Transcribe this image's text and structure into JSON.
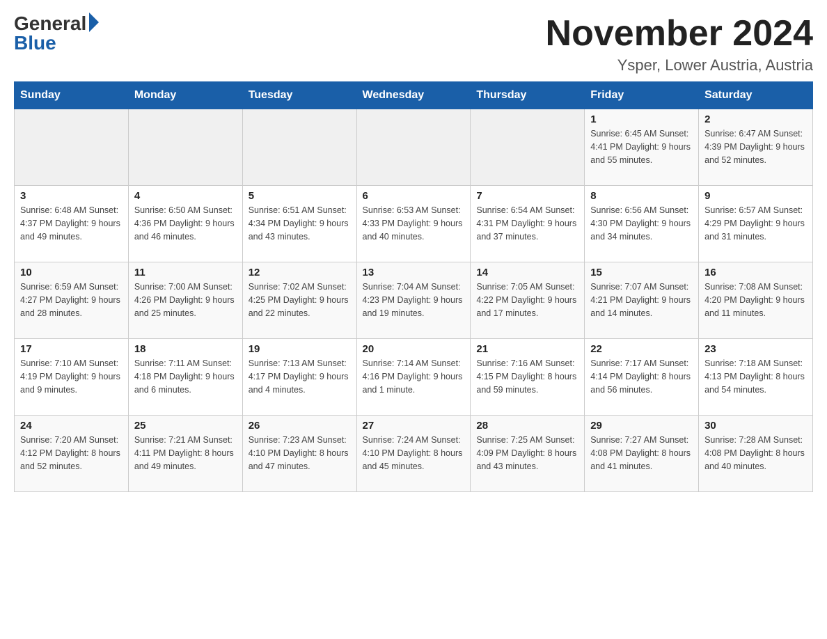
{
  "header": {
    "logo_general": "General",
    "logo_blue": "Blue",
    "month_title": "November 2024",
    "location": "Ysper, Lower Austria, Austria"
  },
  "days_of_week": [
    "Sunday",
    "Monday",
    "Tuesday",
    "Wednesday",
    "Thursday",
    "Friday",
    "Saturday"
  ],
  "weeks": [
    [
      {
        "day": "",
        "info": ""
      },
      {
        "day": "",
        "info": ""
      },
      {
        "day": "",
        "info": ""
      },
      {
        "day": "",
        "info": ""
      },
      {
        "day": "",
        "info": ""
      },
      {
        "day": "1",
        "info": "Sunrise: 6:45 AM\nSunset: 4:41 PM\nDaylight: 9 hours and 55 minutes."
      },
      {
        "day": "2",
        "info": "Sunrise: 6:47 AM\nSunset: 4:39 PM\nDaylight: 9 hours and 52 minutes."
      }
    ],
    [
      {
        "day": "3",
        "info": "Sunrise: 6:48 AM\nSunset: 4:37 PM\nDaylight: 9 hours and 49 minutes."
      },
      {
        "day": "4",
        "info": "Sunrise: 6:50 AM\nSunset: 4:36 PM\nDaylight: 9 hours and 46 minutes."
      },
      {
        "day": "5",
        "info": "Sunrise: 6:51 AM\nSunset: 4:34 PM\nDaylight: 9 hours and 43 minutes."
      },
      {
        "day": "6",
        "info": "Sunrise: 6:53 AM\nSunset: 4:33 PM\nDaylight: 9 hours and 40 minutes."
      },
      {
        "day": "7",
        "info": "Sunrise: 6:54 AM\nSunset: 4:31 PM\nDaylight: 9 hours and 37 minutes."
      },
      {
        "day": "8",
        "info": "Sunrise: 6:56 AM\nSunset: 4:30 PM\nDaylight: 9 hours and 34 minutes."
      },
      {
        "day": "9",
        "info": "Sunrise: 6:57 AM\nSunset: 4:29 PM\nDaylight: 9 hours and 31 minutes."
      }
    ],
    [
      {
        "day": "10",
        "info": "Sunrise: 6:59 AM\nSunset: 4:27 PM\nDaylight: 9 hours and 28 minutes."
      },
      {
        "day": "11",
        "info": "Sunrise: 7:00 AM\nSunset: 4:26 PM\nDaylight: 9 hours and 25 minutes."
      },
      {
        "day": "12",
        "info": "Sunrise: 7:02 AM\nSunset: 4:25 PM\nDaylight: 9 hours and 22 minutes."
      },
      {
        "day": "13",
        "info": "Sunrise: 7:04 AM\nSunset: 4:23 PM\nDaylight: 9 hours and 19 minutes."
      },
      {
        "day": "14",
        "info": "Sunrise: 7:05 AM\nSunset: 4:22 PM\nDaylight: 9 hours and 17 minutes."
      },
      {
        "day": "15",
        "info": "Sunrise: 7:07 AM\nSunset: 4:21 PM\nDaylight: 9 hours and 14 minutes."
      },
      {
        "day": "16",
        "info": "Sunrise: 7:08 AM\nSunset: 4:20 PM\nDaylight: 9 hours and 11 minutes."
      }
    ],
    [
      {
        "day": "17",
        "info": "Sunrise: 7:10 AM\nSunset: 4:19 PM\nDaylight: 9 hours and 9 minutes."
      },
      {
        "day": "18",
        "info": "Sunrise: 7:11 AM\nSunset: 4:18 PM\nDaylight: 9 hours and 6 minutes."
      },
      {
        "day": "19",
        "info": "Sunrise: 7:13 AM\nSunset: 4:17 PM\nDaylight: 9 hours and 4 minutes."
      },
      {
        "day": "20",
        "info": "Sunrise: 7:14 AM\nSunset: 4:16 PM\nDaylight: 9 hours and 1 minute."
      },
      {
        "day": "21",
        "info": "Sunrise: 7:16 AM\nSunset: 4:15 PM\nDaylight: 8 hours and 59 minutes."
      },
      {
        "day": "22",
        "info": "Sunrise: 7:17 AM\nSunset: 4:14 PM\nDaylight: 8 hours and 56 minutes."
      },
      {
        "day": "23",
        "info": "Sunrise: 7:18 AM\nSunset: 4:13 PM\nDaylight: 8 hours and 54 minutes."
      }
    ],
    [
      {
        "day": "24",
        "info": "Sunrise: 7:20 AM\nSunset: 4:12 PM\nDaylight: 8 hours and 52 minutes."
      },
      {
        "day": "25",
        "info": "Sunrise: 7:21 AM\nSunset: 4:11 PM\nDaylight: 8 hours and 49 minutes."
      },
      {
        "day": "26",
        "info": "Sunrise: 7:23 AM\nSunset: 4:10 PM\nDaylight: 8 hours and 47 minutes."
      },
      {
        "day": "27",
        "info": "Sunrise: 7:24 AM\nSunset: 4:10 PM\nDaylight: 8 hours and 45 minutes."
      },
      {
        "day": "28",
        "info": "Sunrise: 7:25 AM\nSunset: 4:09 PM\nDaylight: 8 hours and 43 minutes."
      },
      {
        "day": "29",
        "info": "Sunrise: 7:27 AM\nSunset: 4:08 PM\nDaylight: 8 hours and 41 minutes."
      },
      {
        "day": "30",
        "info": "Sunrise: 7:28 AM\nSunset: 4:08 PM\nDaylight: 8 hours and 40 minutes."
      }
    ]
  ]
}
